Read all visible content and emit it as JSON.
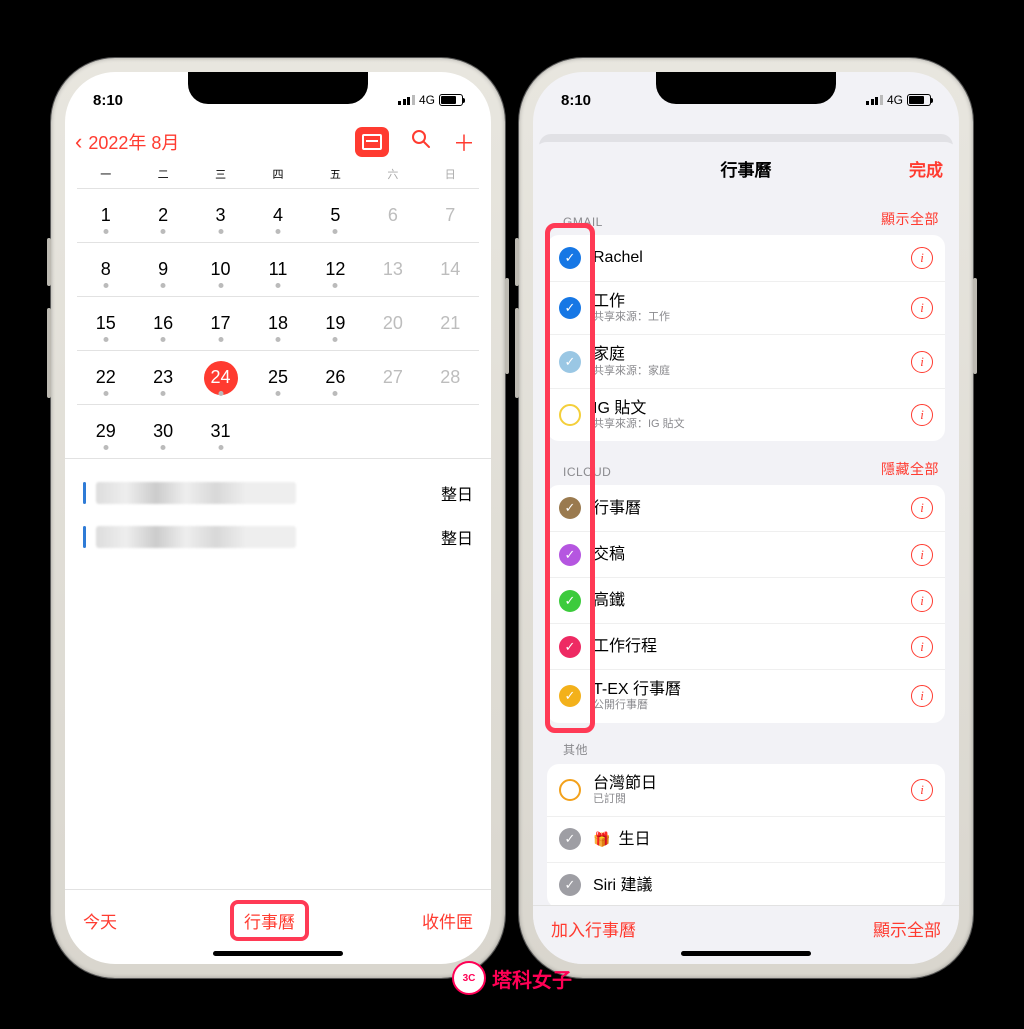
{
  "status": {
    "time": "8:10",
    "net": "4G"
  },
  "left": {
    "month": "2022年 8月",
    "weekdays": [
      "一",
      "二",
      "三",
      "四",
      "五",
      "六",
      "日"
    ],
    "days": [
      {
        "n": "1",
        "dot": true
      },
      {
        "n": "2",
        "dot": true
      },
      {
        "n": "3",
        "dot": true
      },
      {
        "n": "4",
        "dot": true
      },
      {
        "n": "5",
        "dot": true
      },
      {
        "n": "6",
        "wknd": true
      },
      {
        "n": "7",
        "wknd": true
      },
      {
        "n": "8",
        "dot": true
      },
      {
        "n": "9",
        "dot": true
      },
      {
        "n": "10",
        "dot": true
      },
      {
        "n": "11",
        "dot": true
      },
      {
        "n": "12",
        "dot": true
      },
      {
        "n": "13",
        "wknd": true
      },
      {
        "n": "14",
        "wknd": true
      },
      {
        "n": "15",
        "dot": true
      },
      {
        "n": "16",
        "dot": true
      },
      {
        "n": "17",
        "dot": true
      },
      {
        "n": "18",
        "dot": true
      },
      {
        "n": "19",
        "dot": true
      },
      {
        "n": "20",
        "wknd": true
      },
      {
        "n": "21",
        "wknd": true
      },
      {
        "n": "22",
        "dot": true
      },
      {
        "n": "23",
        "dot": true
      },
      {
        "n": "24",
        "today": true,
        "dot": true
      },
      {
        "n": "25",
        "dot": true
      },
      {
        "n": "26",
        "dot": true
      },
      {
        "n": "27",
        "wknd": true
      },
      {
        "n": "28",
        "wknd": true
      },
      {
        "n": "29",
        "dot": true
      },
      {
        "n": "30",
        "dot": true
      },
      {
        "n": "31",
        "dot": true
      },
      {
        "n": ""
      },
      {
        "n": ""
      },
      {
        "n": ""
      },
      {
        "n": ""
      }
    ],
    "events": [
      {
        "allday": "整日"
      },
      {
        "allday": "整日"
      }
    ],
    "footer": {
      "today": "今天",
      "calendars": "行事曆",
      "inbox": "收件匣"
    }
  },
  "right": {
    "title": "行事曆",
    "done": "完成",
    "sections": [
      {
        "name": "GMAIL",
        "action": "顯示全部",
        "rows": [
          {
            "color": "#1677e5",
            "checked": true,
            "title": "Rachel",
            "info": true
          },
          {
            "color": "#1677e5",
            "checked": true,
            "title": "工作",
            "sub": "共享來源：工作",
            "info": true
          },
          {
            "color": "#9ac7e4",
            "checked": true,
            "title": "家庭",
            "sub": "共享來源：家庭",
            "info": true
          },
          {
            "color": "#f4cf3a",
            "hollow": true,
            "title": "IG 貼文",
            "sub": "共享來源：IG 貼文",
            "info": true
          }
        ]
      },
      {
        "name": "ICLOUD",
        "action": "隱藏全部",
        "rows": [
          {
            "color": "#9a7a4f",
            "checked": true,
            "title": "行事曆",
            "info": true
          },
          {
            "color": "#b556e0",
            "checked": true,
            "title": "交稿",
            "info": true
          },
          {
            "color": "#3ccb3c",
            "checked": true,
            "title": "高鐵",
            "info": true
          },
          {
            "color": "#ee2a63",
            "checked": true,
            "title": "工作行程",
            "info": true
          },
          {
            "color": "#f3b11b",
            "checked": true,
            "title": "T-EX 行事曆",
            "sub": "公開行事曆",
            "info": true
          }
        ]
      },
      {
        "name": "其他",
        "rows": [
          {
            "color": "#f3a11b",
            "hollow": true,
            "title": "台灣節日",
            "sub": "已訂閱",
            "info": true
          },
          {
            "color": "#9e9ea4",
            "checked": true,
            "gift": true,
            "title": "生日"
          },
          {
            "color": "#9e9ea4",
            "checked": true,
            "title": "Siri 建議"
          }
        ]
      }
    ],
    "footer": {
      "add": "加入行事曆",
      "showAll": "顯示全部"
    }
  },
  "watermark": "塔科女子"
}
